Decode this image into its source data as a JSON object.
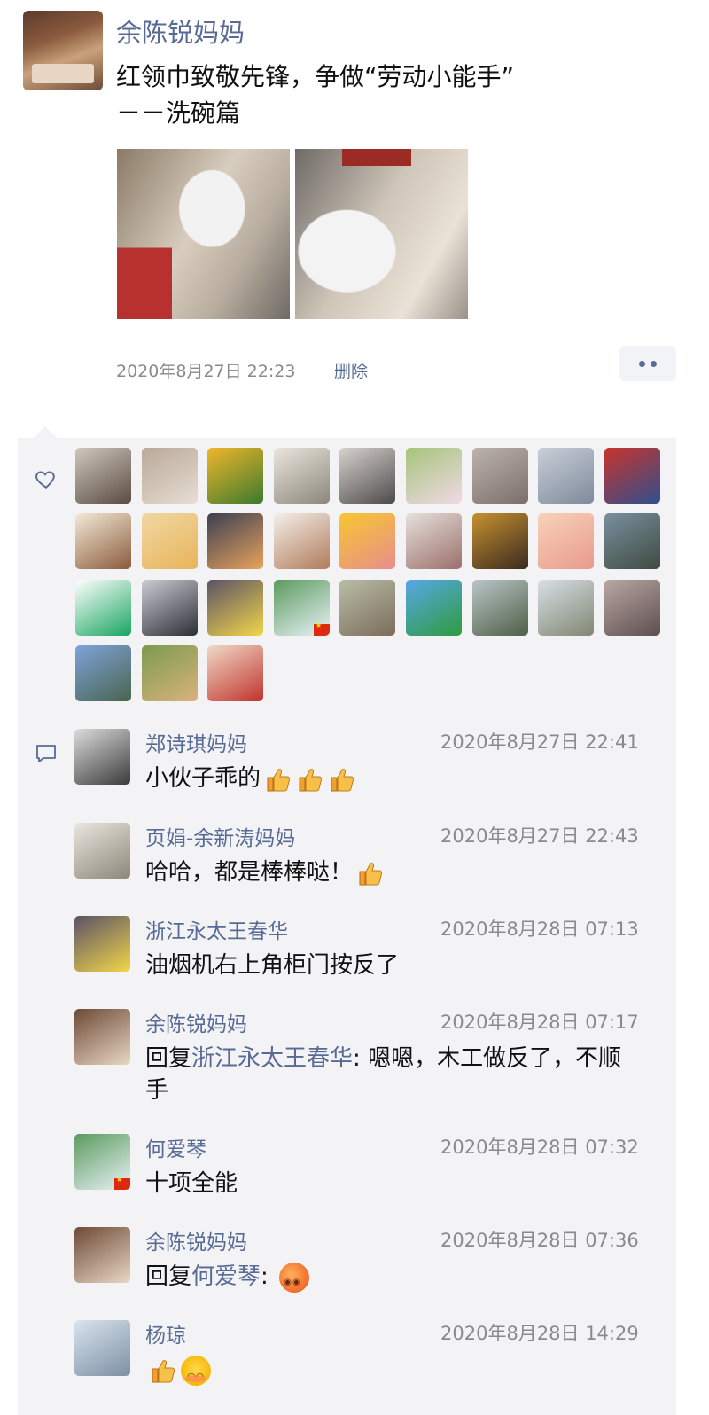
{
  "post": {
    "author": "余陈锐妈妈",
    "text": "红领巾致敬先锋，争做“劳动小能手”\n－－洗碗篇",
    "time": "2020年8月27日 22:23",
    "delete_label": "删除",
    "more_icon": "more-dots-icon"
  },
  "likes": {
    "icon": "heart-icon",
    "avatars": [
      {
        "name": "like-avatar-1",
        "colors": [
          "#cfc7be",
          "#5a4b42"
        ]
      },
      {
        "name": "like-avatar-2",
        "colors": [
          "#b9a999",
          "#e7ddd2"
        ]
      },
      {
        "name": "like-avatar-3",
        "colors": [
          "#f0b62a",
          "#3c7a2e"
        ]
      },
      {
        "name": "like-avatar-4",
        "colors": [
          "#eae6df",
          "#8c8779"
        ]
      },
      {
        "name": "like-avatar-5",
        "colors": [
          "#d7d2cf",
          "#4d4a4a"
        ]
      },
      {
        "name": "like-avatar-6",
        "colors": [
          "#a6c47a",
          "#f0d9e6"
        ]
      },
      {
        "name": "like-avatar-7",
        "colors": [
          "#bdb3ad",
          "#7a6f6b"
        ]
      },
      {
        "name": "like-avatar-8",
        "colors": [
          "#c9cfd8",
          "#7e8a9b"
        ]
      },
      {
        "name": "like-avatar-9",
        "colors": [
          "#c8342b",
          "#2f4f8f"
        ]
      },
      {
        "name": "like-avatar-10",
        "colors": [
          "#f3ead6",
          "#8a5a3b"
        ]
      },
      {
        "name": "like-avatar-11",
        "colors": [
          "#f1d7a2",
          "#e8b45a"
        ]
      },
      {
        "name": "like-avatar-12",
        "colors": [
          "#3b3f52",
          "#e9a35c"
        ]
      },
      {
        "name": "like-avatar-13",
        "colors": [
          "#f4efe9",
          "#b07b5a"
        ]
      },
      {
        "name": "like-avatar-14",
        "colors": [
          "#f7c730",
          "#e88d8c"
        ]
      },
      {
        "name": "like-avatar-15",
        "colors": [
          "#e6e0dc",
          "#9b6f6a"
        ]
      },
      {
        "name": "like-avatar-16",
        "colors": [
          "#c7902f",
          "#3a2a20"
        ]
      },
      {
        "name": "like-avatar-17",
        "colors": [
          "#f7d2b9",
          "#e99a8c"
        ]
      },
      {
        "name": "like-avatar-18",
        "colors": [
          "#7a8f9f",
          "#3e4b40"
        ]
      },
      {
        "name": "like-avatar-19",
        "colors": [
          "#ffffff",
          "#19a55f"
        ]
      },
      {
        "name": "like-avatar-20",
        "colors": [
          "#c9ccd1",
          "#2b2f36"
        ]
      },
      {
        "name": "like-avatar-21",
        "colors": [
          "#5b5266",
          "#f2d64a"
        ]
      },
      {
        "name": "like-avatar-22",
        "colors": [
          "#5b9a5e",
          "#e9f2f7"
        ],
        "flag": true
      },
      {
        "name": "like-avatar-23",
        "colors": [
          "#b9bea6",
          "#7b6c5a"
        ]
      },
      {
        "name": "like-avatar-24",
        "colors": [
          "#57a7e6",
          "#2f9b3f"
        ]
      },
      {
        "name": "like-avatar-25",
        "colors": [
          "#b9c6c8",
          "#4f5e46"
        ]
      },
      {
        "name": "like-avatar-26",
        "colors": [
          "#d9dfe5",
          "#7f8773"
        ]
      },
      {
        "name": "like-avatar-27",
        "colors": [
          "#b8a7a4",
          "#5e4e4e"
        ]
      },
      {
        "name": "like-avatar-28",
        "colors": [
          "#7ea3d9",
          "#49644f"
        ]
      },
      {
        "name": "like-avatar-29",
        "colors": [
          "#7c9b4f",
          "#d9b27b"
        ]
      },
      {
        "name": "like-avatar-30",
        "colors": [
          "#f0d9c6",
          "#c0332d"
        ]
      }
    ]
  },
  "comments": {
    "icon": "comment-bubble-icon",
    "items": [
      {
        "name": "郑诗琪妈妈",
        "time": "2020年8月27日 22:41",
        "text": "小伙子乖的",
        "emojis": [
          "thumb",
          "thumb",
          "thumb"
        ],
        "avatar": [
          "#dcdcdc",
          "#3a3a3a"
        ]
      },
      {
        "name": "页娟-余新涛妈妈",
        "time": "2020年8月27日 22:43",
        "text": "哈哈，都是棒棒哒！",
        "emojis": [
          "thumb"
        ],
        "avatar": [
          "#eae6df",
          "#8c8779"
        ]
      },
      {
        "name": "浙江永太王春华",
        "time": "2020年8月28日 07:13",
        "text": "油烟机右上角柜门按反了",
        "emojis": [],
        "avatar": [
          "#5b5266",
          "#f2d64a"
        ]
      },
      {
        "name": "余陈锐妈妈",
        "time": "2020年8月28日 07:17",
        "reply_prefix": "回复",
        "reply_to": "浙江永太王春华",
        "reply_sep": ": ",
        "text": "嗯嗯，木工做反了，不顺手",
        "emojis": [],
        "avatar": [
          "#6d4a36",
          "#e8d7c4"
        ]
      },
      {
        "name": "何爱琴",
        "time": "2020年8月28日 07:32",
        "text": "十项全能",
        "emojis": [],
        "avatar": [
          "#5b9a5e",
          "#e9f2f7"
        ],
        "flag": true
      },
      {
        "name": "余陈锐妈妈",
        "time": "2020年8月28日 07:36",
        "reply_prefix": "回复",
        "reply_to": "何爱琴",
        "reply_sep": ": ",
        "text": "",
        "emojis": [
          "flush"
        ],
        "avatar": [
          "#6d4a36",
          "#e8d7c4"
        ]
      },
      {
        "name": "杨琼",
        "time": "2020年8月28日 14:29",
        "text": "",
        "emojis": [
          "thumb",
          "blush"
        ],
        "avatar": [
          "#d9e4ee",
          "#7c8fa3"
        ]
      }
    ]
  }
}
